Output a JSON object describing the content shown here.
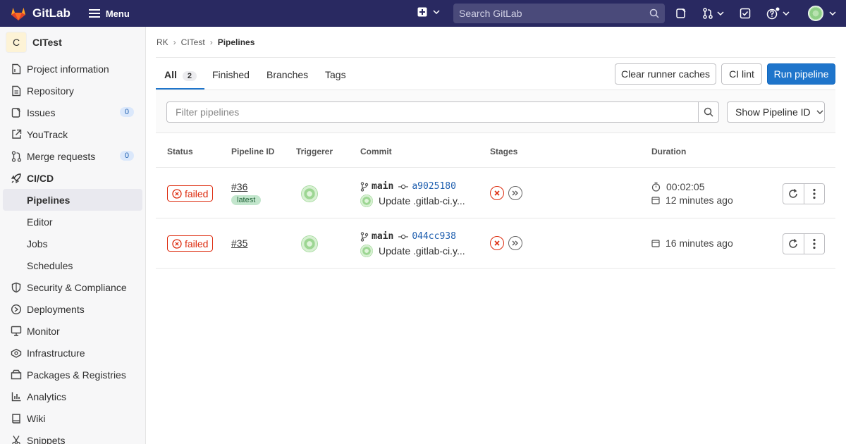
{
  "topbar": {
    "brand": "GitLab",
    "menu_label": "Menu",
    "search_placeholder": "Search GitLab"
  },
  "sidebar": {
    "project_initial": "C",
    "project_name": "CITest",
    "items": [
      {
        "label": "Project information",
        "icon": "info-doc-icon"
      },
      {
        "label": "Repository",
        "icon": "doc-icon"
      },
      {
        "label": "Issues",
        "icon": "issues-icon",
        "badge": "0"
      },
      {
        "label": "YouTrack",
        "icon": "external-link-icon"
      },
      {
        "label": "Merge requests",
        "icon": "merge-request-icon",
        "badge": "0"
      },
      {
        "label": "CI/CD",
        "icon": "rocket-icon"
      },
      {
        "label": "Security & Compliance",
        "icon": "shield-icon"
      },
      {
        "label": "Deployments",
        "icon": "deploy-icon"
      },
      {
        "label": "Monitor",
        "icon": "monitor-icon"
      },
      {
        "label": "Infrastructure",
        "icon": "cloud-icon"
      },
      {
        "label": "Packages & Registries",
        "icon": "package-icon"
      },
      {
        "label": "Analytics",
        "icon": "chart-icon"
      },
      {
        "label": "Wiki",
        "icon": "book-icon"
      },
      {
        "label": "Snippets",
        "icon": "scissors-icon"
      }
    ],
    "cicd_sub": [
      "Pipelines",
      "Editor",
      "Jobs",
      "Schedules"
    ]
  },
  "breadcrumb": [
    "RK",
    "CITest",
    "Pipelines"
  ],
  "tabs": [
    {
      "label": "All",
      "count": "2"
    },
    {
      "label": "Finished"
    },
    {
      "label": "Branches"
    },
    {
      "label": "Tags"
    }
  ],
  "buttons": {
    "clear_caches": "Clear runner caches",
    "ci_lint": "CI lint",
    "run_pipeline": "Run pipeline"
  },
  "filter": {
    "placeholder": "Filter pipelines",
    "dropdown": "Show Pipeline ID"
  },
  "table": {
    "headers": [
      "Status",
      "Pipeline ID",
      "Triggerer",
      "Commit",
      "Stages",
      "Duration"
    ],
    "rows": [
      {
        "status": "failed",
        "pipeline_id": "#36",
        "tag": "latest",
        "branch": "main",
        "sha": "a9025180",
        "message": "Update .gitlab-ci.y...",
        "duration": "00:02:05",
        "finished": "12 minutes ago"
      },
      {
        "status": "failed",
        "pipeline_id": "#35",
        "branch": "main",
        "sha": "044cc938",
        "message": "Update .gitlab-ci.y...",
        "finished": "16 minutes ago"
      }
    ]
  },
  "colors": {
    "topbar": "#292961",
    "primary": "#1f75cb",
    "danger": "#dd2b0e"
  }
}
